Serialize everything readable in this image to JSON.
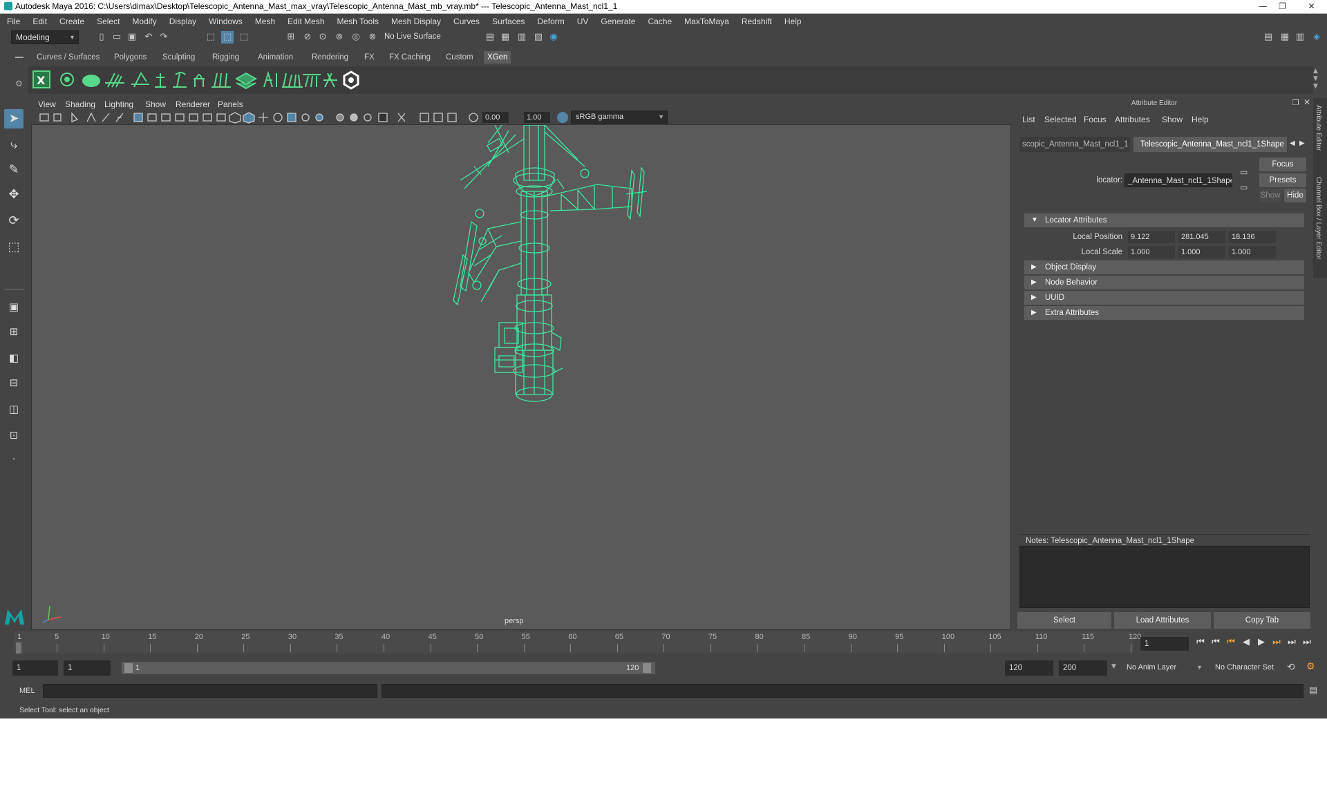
{
  "window": {
    "title": "Autodesk Maya 2016: C:\\Users\\dimax\\Desktop\\Telescopic_Antenna_Mast_max_vray\\Telescopic_Antenna_Mast_mb_vray.mb*   ---   Telescopic_Antenna_Mast_ncl1_1",
    "controls": [
      "—",
      "❐",
      "✕"
    ]
  },
  "menubar": [
    "File",
    "Edit",
    "Create",
    "Select",
    "Modify",
    "Display",
    "Windows",
    "Mesh",
    "Edit Mesh",
    "Mesh Tools",
    "Mesh Display",
    "Curves",
    "Surfaces",
    "Deform",
    "UV",
    "Generate",
    "Cache",
    "MaxToMaya",
    "Redshift",
    "Help"
  ],
  "statusline": {
    "mode": "Modeling",
    "live_surface": "No Live Surface"
  },
  "shelf": {
    "tabs": [
      "Curves / Surfaces",
      "Polygons",
      "Sculpting",
      "Rigging",
      "Animation",
      "Rendering",
      "FX",
      "FX Caching",
      "Custom",
      "XGen"
    ],
    "active_tab": "XGen"
  },
  "viewport": {
    "menu": [
      "View",
      "Shading",
      "Lighting",
      "Show",
      "Renderer",
      "Panels"
    ],
    "exposure": "0.00",
    "gamma": "1.00",
    "color_space": "sRGB gamma",
    "camera": "persp"
  },
  "attribute_editor": {
    "title": "Attribute Editor",
    "menu": [
      "List",
      "Selected",
      "Focus",
      "Attributes",
      "Show",
      "Help"
    ],
    "tabs": [
      "scopic_Antenna_Mast_ncl1_1",
      "Telescopic_Antenna_Mast_ncl1_1Shape"
    ],
    "node_label": "locator:",
    "node_value": "_Antenna_Mast_ncl1_1Shape",
    "focus_label": "Focus",
    "presets_label": "Presets",
    "show_label": "Show",
    "hide_label": "Hide",
    "sections": {
      "locator": "Locator Attributes",
      "object_display": "Object Display",
      "node_behavior": "Node Behavior",
      "uuid": "UUID",
      "extra": "Extra Attributes"
    },
    "local_position": {
      "label": "Local Position",
      "x": "9.122",
      "y": "281.045",
      "z": "18.136"
    },
    "local_scale": {
      "label": "Local Scale",
      "x": "1.000",
      "y": "1.000",
      "z": "1.000"
    },
    "notes": "Notes:  Telescopic_Antenna_Mast_ncl1_1Shape",
    "buttons": {
      "select": "Select",
      "load": "Load Attributes",
      "copy": "Copy Tab"
    },
    "side_tabs": [
      "Attribute Editor",
      "Channel Box / Layer Editor"
    ]
  },
  "timeline": {
    "ticks": [
      "1",
      "5",
      "10",
      "15",
      "20",
      "25",
      "30",
      "35",
      "40",
      "45",
      "50",
      "55",
      "60",
      "65",
      "70",
      "75",
      "80",
      "85",
      "90",
      "95",
      "100",
      "105",
      "110",
      "115",
      "120"
    ],
    "current_frame": "1"
  },
  "range": {
    "start": "1",
    "playback_start": "1",
    "slider_start": "1",
    "slider_end": "120",
    "playback_end": "120",
    "end": "200",
    "anim_layer": "No Anim Layer",
    "character_set": "No Character Set"
  },
  "command_line": {
    "label": "MEL"
  },
  "help_line": "Select Tool: select an object",
  "colors": {
    "wireframe": "#3ee8a0",
    "accent": "#5285a6",
    "viewport_bg": "#5a5a5a"
  }
}
